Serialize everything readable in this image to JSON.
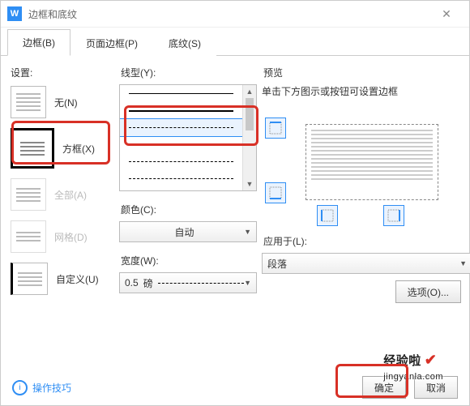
{
  "title": "边框和底纹",
  "app_icon_letter": "W",
  "tabs": [
    {
      "label": "边框(B)",
      "active": true
    },
    {
      "label": "页面边框(P)",
      "active": false
    },
    {
      "label": "底纹(S)",
      "active": false
    }
  ],
  "settings": {
    "label": "设置:",
    "items": [
      {
        "label": "无(N)",
        "kind": "none"
      },
      {
        "label": "方框(X)",
        "kind": "box",
        "selected": true
      },
      {
        "label": "全部(A)",
        "kind": "all",
        "disabled": true
      },
      {
        "label": "网格(D)",
        "kind": "grid",
        "disabled": true
      },
      {
        "label": "自定义(U)",
        "kind": "custom"
      }
    ]
  },
  "line_type": {
    "label": "线型(Y):"
  },
  "color": {
    "label": "颜色(C):",
    "value": "自动"
  },
  "width": {
    "label": "宽度(W):",
    "value": "0.5",
    "unit": "磅"
  },
  "preview": {
    "label": "预览",
    "hint": "单击下方图示或按钮可设置边框"
  },
  "apply_to": {
    "label": "应用于(L):",
    "value": "段落"
  },
  "options_btn": "选项(O)...",
  "help_link": "操作技巧",
  "ok_btn": "确定",
  "cancel_btn": "取消",
  "watermark": "经验啦",
  "watermark_domain": "jingyanla.com"
}
